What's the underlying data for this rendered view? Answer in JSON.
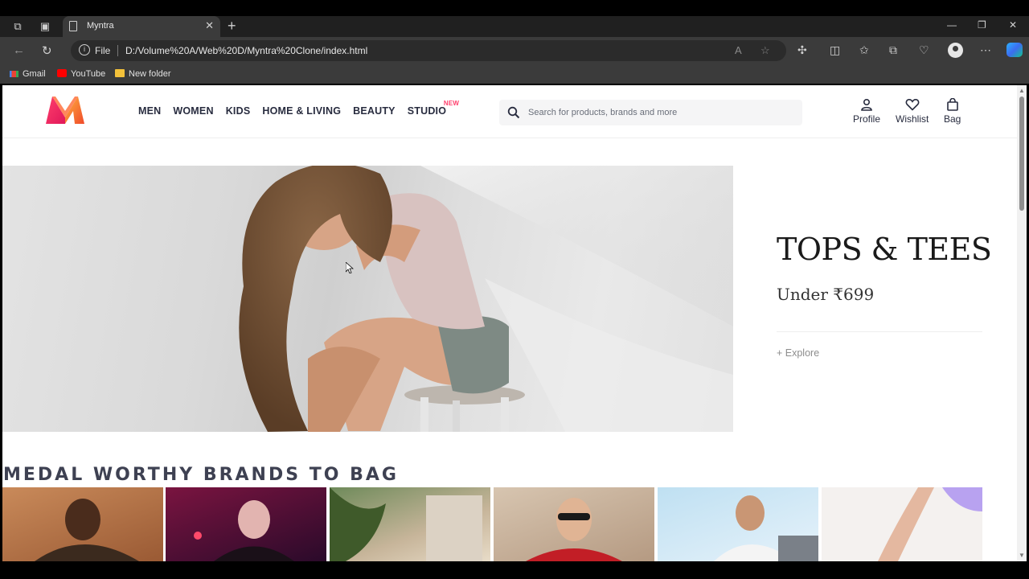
{
  "browser": {
    "tab_title": "Myntra",
    "address_scheme": "File",
    "url": "D:/Volume%20A/Web%20D/Myntra%20Clone/index.html",
    "bookmarks": [
      {
        "label": "Gmail",
        "icon": "gmail-icon"
      },
      {
        "label": "YouTube",
        "icon": "youtube-icon"
      },
      {
        "label": "New folder",
        "icon": "folder-icon"
      }
    ]
  },
  "site": {
    "nav": [
      {
        "label": "MEN"
      },
      {
        "label": "WOMEN"
      },
      {
        "label": "KIDS"
      },
      {
        "label": "HOME & LIVING"
      },
      {
        "label": "BEAUTY"
      },
      {
        "label": "STUDIO",
        "badge": "NEW"
      }
    ],
    "search_placeholder": "Search for products, brands and more",
    "actions": [
      {
        "label": "Profile",
        "icon": "profile-icon"
      },
      {
        "label": "Wishlist",
        "icon": "heart-icon"
      },
      {
        "label": "Bag",
        "icon": "bag-icon"
      }
    ],
    "brand_color": "#ff3f6c"
  },
  "hero": {
    "title": "TOPS & TEES",
    "subtitle": "Under ₹699",
    "cta": "+ Explore"
  },
  "brands_section": {
    "title": "MEDAL WORTHY BRANDS TO BAG",
    "tiles": [
      "brand-tile-1",
      "brand-tile-2",
      "brand-tile-3",
      "brand-tile-4",
      "brand-tile-5",
      "brand-tile-6"
    ]
  }
}
